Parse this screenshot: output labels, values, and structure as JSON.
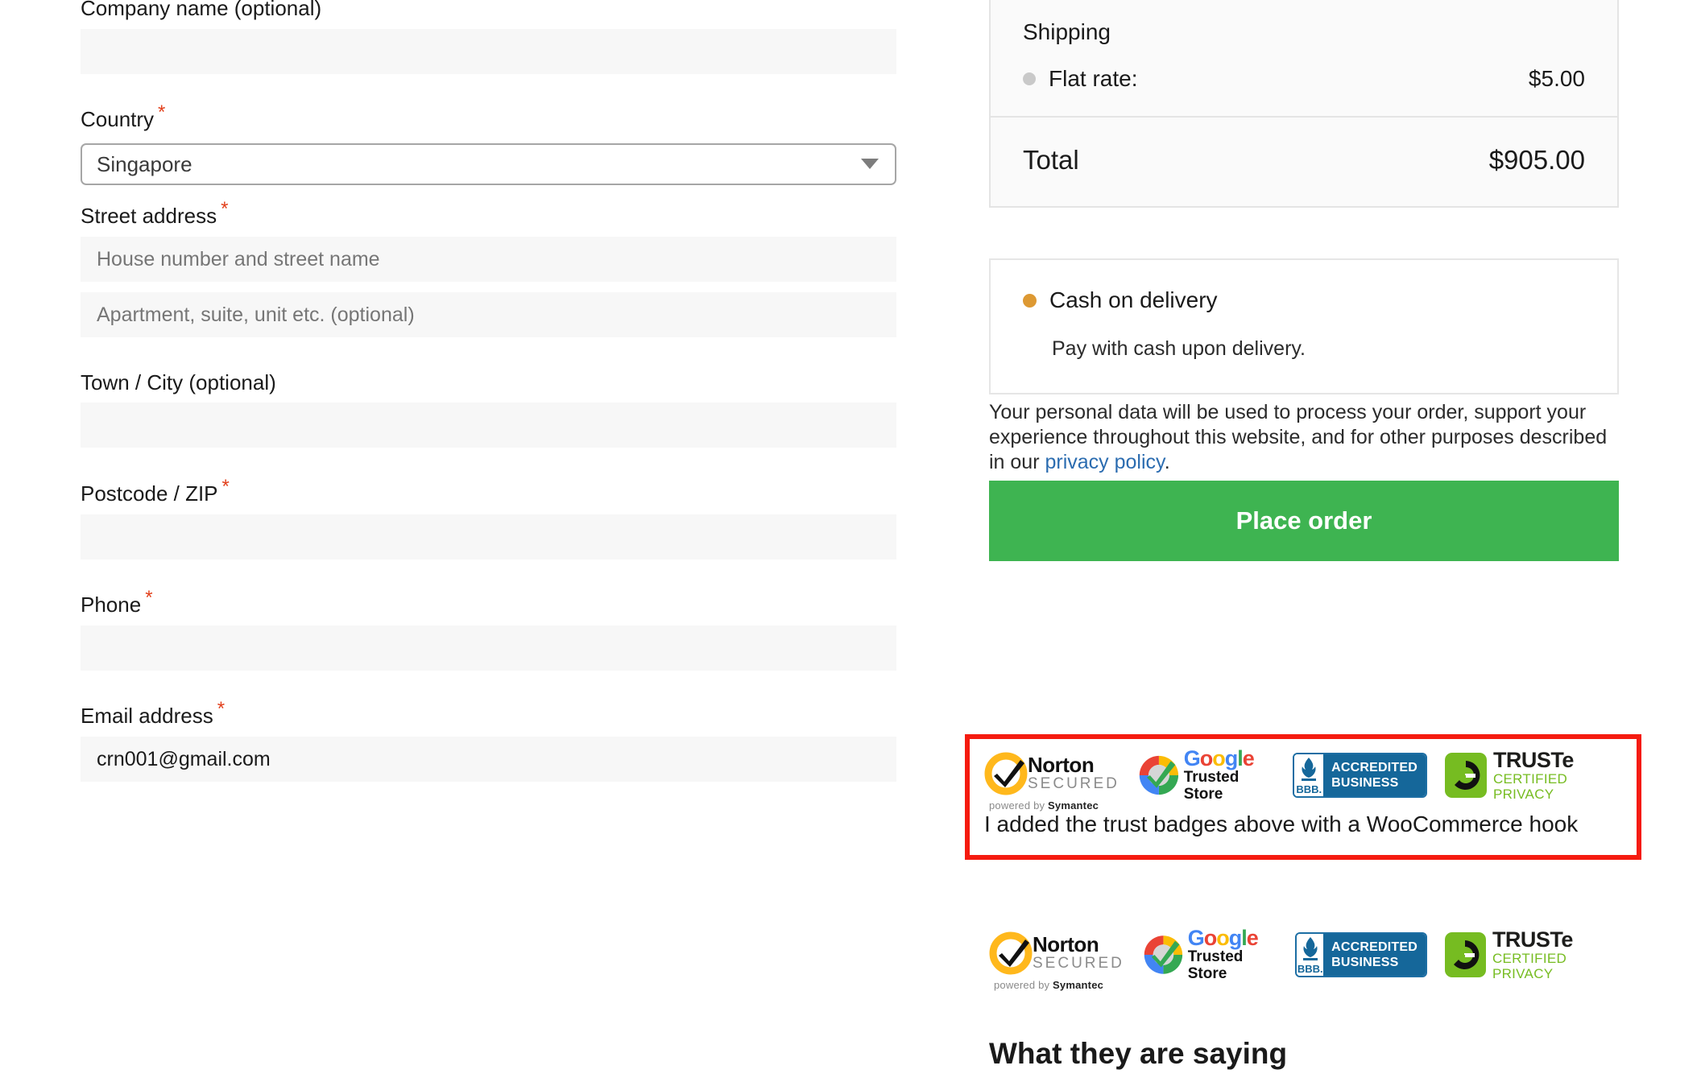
{
  "billing": {
    "fields": [
      {
        "id": "company",
        "label": "Company name (optional)",
        "required": false,
        "type": "text",
        "value": "",
        "placeholder": ""
      },
      {
        "id": "country",
        "label": "Country",
        "required": true,
        "type": "select",
        "value": "Singapore",
        "placeholder": ""
      },
      {
        "id": "street1",
        "label": "Street address",
        "required": true,
        "type": "text",
        "value": "",
        "placeholder": "House number and street name"
      },
      {
        "id": "street2",
        "label": "",
        "required": false,
        "type": "text",
        "value": "",
        "placeholder": "Apartment, suite, unit etc. (optional)"
      },
      {
        "id": "city",
        "label": "Town / City (optional)",
        "required": false,
        "type": "text",
        "value": "",
        "placeholder": ""
      },
      {
        "id": "postcode",
        "label": "Postcode / ZIP",
        "required": true,
        "type": "text",
        "value": "",
        "placeholder": ""
      },
      {
        "id": "phone",
        "label": "Phone",
        "required": true,
        "type": "text",
        "value": "",
        "placeholder": ""
      },
      {
        "id": "email",
        "label": "Email address",
        "required": true,
        "type": "text",
        "value": "crn001@gmail.com",
        "placeholder": ""
      }
    ],
    "required_marker": "*"
  },
  "order_totals": {
    "shipping_title": "Shipping",
    "shipping_option_label": "Flat rate:",
    "shipping_option_amount": "$5.00",
    "shipping_option_selected": false,
    "total_label": "Total",
    "total_amount": "$905.00"
  },
  "payment": {
    "method_label": "Cash on delivery",
    "method_selected": true,
    "method_description": "Pay with cash upon delivery.",
    "accent_color": "#dd9933"
  },
  "privacy": {
    "text_before": "Your personal data will be used to process your order, support your experience throughout this website, and for other purposes described in our ",
    "link_text": "privacy policy",
    "text_after": "."
  },
  "place_order": {
    "label": "Place order",
    "color": "#3eb451"
  },
  "trust_badges": [
    {
      "name": "norton-secured",
      "line1": "Norton",
      "line2": "SECURED",
      "line3_prefix": "powered by ",
      "line3_bold": "Symantec"
    },
    {
      "name": "google-trusted-store",
      "line1": "Google",
      "line2": "Trusted Store"
    },
    {
      "name": "bbb-accredited-business",
      "line1": "BBB.",
      "line2": "ACCREDITED",
      "line3": "BUSINESS"
    },
    {
      "name": "truste-certified-privacy",
      "line1": "TRUSTe",
      "line2": "CERTIFIED PRIVACY"
    }
  ],
  "annotation": {
    "text": "I added the trust badges above with a WooCommerce hook",
    "border_color": "#f51b10"
  },
  "testimonials": {
    "heading": "What they are saying"
  }
}
